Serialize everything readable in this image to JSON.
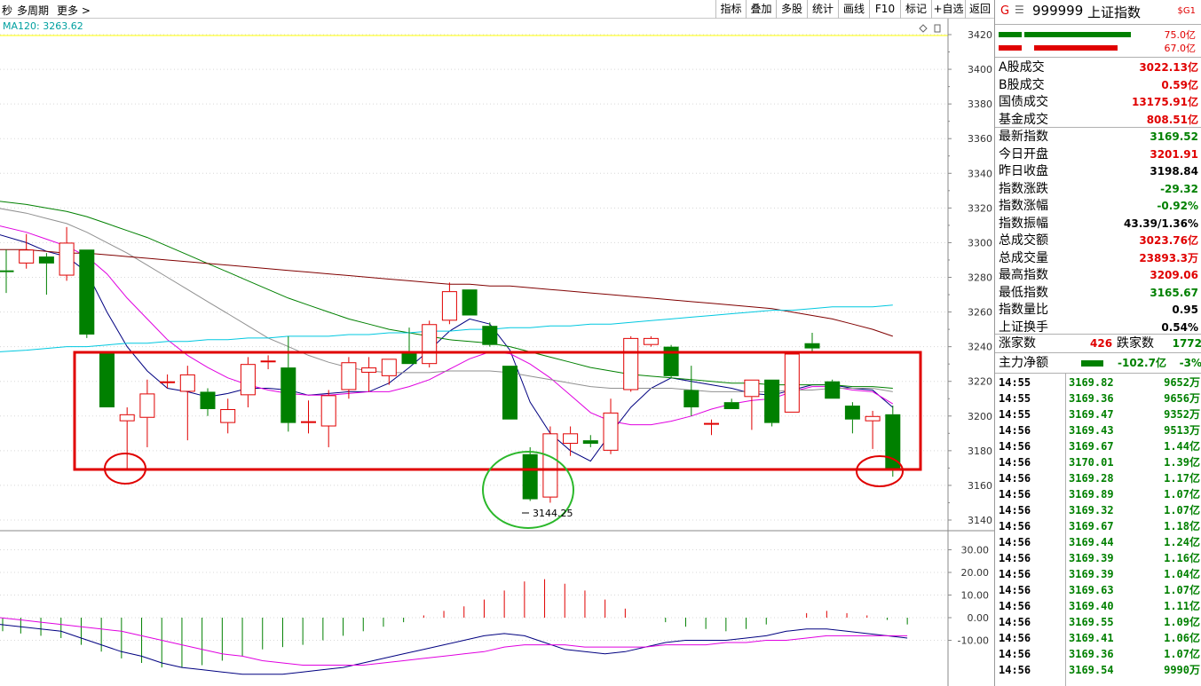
{
  "toolbar": {
    "left_items": [
      "秒",
      "多周期",
      "更多 >"
    ],
    "buttons": [
      "指标",
      "叠加",
      "多股",
      "统计",
      "画线",
      "F10",
      "标记",
      "+自选",
      "返回"
    ]
  },
  "indicator_label": "MA120: 3263.62",
  "quote": {
    "code": "999999",
    "name": "上证指数",
    "badge": "$G1",
    "bar_top_value": "75.0亿",
    "bar_bottom_value": "67.0亿",
    "rows": [
      {
        "label": "A股成交",
        "value": "3022.13亿",
        "color": "red"
      },
      {
        "label": "B股成交",
        "value": "0.59亿",
        "color": "red"
      },
      {
        "label": "国债成交",
        "value": "13175.91亿",
        "color": "red"
      },
      {
        "label": "基金成交",
        "value": "808.51亿",
        "color": "red"
      },
      {
        "label": "最新指数",
        "value": "3169.52",
        "color": "green"
      },
      {
        "label": "今日开盘",
        "value": "3201.91",
        "color": "red"
      },
      {
        "label": "昨日收盘",
        "value": "3198.84",
        "color": "black"
      },
      {
        "label": "指数涨跌",
        "value": "-29.32",
        "color": "green"
      },
      {
        "label": "指数涨幅",
        "value": "-0.92%",
        "color": "green"
      },
      {
        "label": "指数振幅",
        "value": "43.39/1.36%",
        "color": "black"
      },
      {
        "label": "总成交额",
        "value": "3023.76亿",
        "color": "red"
      },
      {
        "label": "总成交量",
        "value": "23893.3万",
        "color": "red"
      },
      {
        "label": "最高指数",
        "value": "3209.06",
        "color": "red"
      },
      {
        "label": "最低指数",
        "value": "3165.67",
        "color": "green"
      },
      {
        "label": "指数量比",
        "value": "0.95",
        "color": "black"
      },
      {
        "label": "上证换手",
        "value": "0.54%",
        "color": "black"
      }
    ],
    "breadth": {
      "up_label": "涨家数",
      "up_value": "426",
      "down_label": "跌家数",
      "down_value": "1772"
    },
    "main_flow": {
      "label": "主力净额",
      "value": "-102.7亿",
      "pct": "-3%"
    },
    "ticks": [
      {
        "time": "14:55",
        "price": "3169.82",
        "vol": "9652万"
      },
      {
        "time": "14:55",
        "price": "3169.36",
        "vol": "9656万"
      },
      {
        "time": "14:55",
        "price": "3169.47",
        "vol": "9352万"
      },
      {
        "time": "14:56",
        "price": "3169.43",
        "vol": "9513万"
      },
      {
        "time": "14:56",
        "price": "3169.67",
        "vol": "1.44亿"
      },
      {
        "time": "14:56",
        "price": "3170.01",
        "vol": "1.39亿"
      },
      {
        "time": "14:56",
        "price": "3169.28",
        "vol": "1.17亿"
      },
      {
        "time": "14:56",
        "price": "3169.89",
        "vol": "1.07亿"
      },
      {
        "time": "14:56",
        "price": "3169.32",
        "vol": "1.07亿"
      },
      {
        "time": "14:56",
        "price": "3169.67",
        "vol": "1.18亿"
      },
      {
        "time": "14:56",
        "price": "3169.44",
        "vol": "1.24亿"
      },
      {
        "time": "14:56",
        "price": "3169.39",
        "vol": "1.16亿"
      },
      {
        "time": "14:56",
        "price": "3169.39",
        "vol": "1.04亿"
      },
      {
        "time": "14:56",
        "price": "3169.63",
        "vol": "1.07亿"
      },
      {
        "time": "14:56",
        "price": "3169.40",
        "vol": "1.11亿"
      },
      {
        "time": "14:56",
        "price": "3169.55",
        "vol": "1.09亿"
      },
      {
        "time": "14:56",
        "price": "3169.41",
        "vol": "1.06亿"
      },
      {
        "time": "14:56",
        "price": "3169.36",
        "vol": "1.07亿"
      },
      {
        "time": "14:56",
        "price": "3169.54",
        "vol": "9990万"
      }
    ],
    "colors": {
      "red": "#e00000",
      "green": "#008000",
      "black": "#000000"
    }
  },
  "chart_data": {
    "type": "candlestick",
    "price_axis": {
      "min": 3140,
      "max": 3420,
      "ticks": [
        3140,
        3160,
        3180,
        3200,
        3220,
        3240,
        3260,
        3280,
        3300,
        3320,
        3340,
        3360,
        3380,
        3400,
        3420
      ]
    },
    "macd_axis": {
      "min": -10,
      "max": 30,
      "ticks": [
        "30.00",
        "20.00",
        "10.00",
        "0.00",
        "-10.00"
      ]
    },
    "annotation": "3144.25",
    "candles": [
      {
        "o": 3284,
        "h": 3296,
        "l": 3271,
        "c": 3283
      },
      {
        "o": 3288,
        "h": 3305,
        "l": 3285,
        "c": 3296
      },
      {
        "o": 3292,
        "h": 3294,
        "l": 3270,
        "c": 3288
      },
      {
        "o": 3281,
        "h": 3309,
        "l": 3278,
        "c": 3300
      },
      {
        "o": 3296,
        "h": 3296,
        "l": 3245,
        "c": 3247
      },
      {
        "o": 3237,
        "h": 3237,
        "l": 3205,
        "c": 3205
      },
      {
        "o": 3197,
        "h": 3205,
        "l": 3169,
        "c": 3201
      },
      {
        "o": 3199,
        "h": 3221,
        "l": 3182,
        "c": 3213
      },
      {
        "o": 3219,
        "h": 3224,
        "l": 3216,
        "c": 3220
      },
      {
        "o": 3214,
        "h": 3229,
        "l": 3186,
        "c": 3224
      },
      {
        "o": 3214,
        "h": 3216,
        "l": 3200,
        "c": 3204
      },
      {
        "o": 3196,
        "h": 3210,
        "l": 3190,
        "c": 3204
      },
      {
        "o": 3212,
        "h": 3234,
        "l": 3205,
        "c": 3230
      },
      {
        "o": 3231,
        "h": 3235,
        "l": 3227,
        "c": 3232
      },
      {
        "o": 3228,
        "h": 3246,
        "l": 3191,
        "c": 3196
      },
      {
        "o": 3196,
        "h": 3209,
        "l": 3190,
        "c": 3197
      },
      {
        "o": 3194,
        "h": 3215,
        "l": 3182,
        "c": 3212
      },
      {
        "o": 3215,
        "h": 3234,
        "l": 3210,
        "c": 3231
      },
      {
        "o": 3225,
        "h": 3234,
        "l": 3214,
        "c": 3228
      },
      {
        "o": 3223,
        "h": 3233,
        "l": 3218,
        "c": 3233
      },
      {
        "o": 3237,
        "h": 3251,
        "l": 3230,
        "c": 3230
      },
      {
        "o": 3230,
        "h": 3255,
        "l": 3228,
        "c": 3253
      },
      {
        "o": 3255,
        "h": 3277,
        "l": 3253,
        "c": 3272
      },
      {
        "o": 3273,
        "h": 3273,
        "l": 3258,
        "c": 3258
      },
      {
        "o": 3252,
        "h": 3254,
        "l": 3240,
        "c": 3241
      },
      {
        "o": 3229,
        "h": 3229,
        "l": 3198,
        "c": 3198
      },
      {
        "o": 3178,
        "h": 3182,
        "l": 3151,
        "c": 3152
      },
      {
        "o": 3153,
        "h": 3194,
        "l": 3150,
        "c": 3190
      },
      {
        "o": 3184,
        "h": 3194,
        "l": 3177,
        "c": 3190
      },
      {
        "o": 3186,
        "h": 3189,
        "l": 3182,
        "c": 3184
      },
      {
        "o": 3180,
        "h": 3210,
        "l": 3178,
        "c": 3202
      },
      {
        "o": 3215,
        "h": 3246,
        "l": 3214,
        "c": 3245
      },
      {
        "o": 3241,
        "h": 3246,
        "l": 3240,
        "c": 3245
      },
      {
        "o": 3240,
        "h": 3241,
        "l": 3222,
        "c": 3223
      },
      {
        "o": 3215,
        "h": 3229,
        "l": 3200,
        "c": 3205
      },
      {
        "o": 3195,
        "h": 3198,
        "l": 3189,
        "c": 3196
      },
      {
        "o": 3208,
        "h": 3210,
        "l": 3204,
        "c": 3204
      },
      {
        "o": 3211,
        "h": 3221,
        "l": 3192,
        "c": 3221
      },
      {
        "o": 3221,
        "h": 3221,
        "l": 3194,
        "c": 3196
      },
      {
        "o": 3202,
        "h": 3237,
        "l": 3202,
        "c": 3236
      },
      {
        "o": 3242,
        "h": 3248,
        "l": 3236,
        "c": 3239
      },
      {
        "o": 3220,
        "h": 3221,
        "l": 3210,
        "c": 3210
      },
      {
        "o": 3206,
        "h": 3208,
        "l": 3190,
        "c": 3198
      },
      {
        "o": 3197,
        "h": 3203,
        "l": 3181,
        "c": 3200
      },
      {
        "o": 3201,
        "h": 3206,
        "l": 3165,
        "c": 3169
      }
    ],
    "ma_lines": [
      {
        "name": "MA5",
        "color": "#000080",
        "values": [
          3305,
          3300,
          3295,
          3292,
          3283,
          3260,
          3240,
          3226,
          3216,
          3214,
          3211,
          3213,
          3216,
          3216,
          3215,
          3212,
          3213,
          3214,
          3214,
          3219,
          3228,
          3238,
          3249,
          3256,
          3253,
          3238,
          3208,
          3190,
          3180,
          3174,
          3190,
          3205,
          3216,
          3222,
          3220,
          3218,
          3216,
          3213,
          3212,
          3215,
          3218,
          3218,
          3216,
          3215,
          3205
        ]
      },
      {
        "name": "MA10",
        "color": "#e000e0",
        "values": [
          3310,
          3306,
          3302,
          3298,
          3292,
          3282,
          3268,
          3256,
          3244,
          3235,
          3228,
          3222,
          3218,
          3215,
          3213,
          3212,
          3212,
          3213,
          3214,
          3214,
          3217,
          3221,
          3227,
          3233,
          3237,
          3236,
          3230,
          3222,
          3212,
          3202,
          3197,
          3195,
          3195,
          3197,
          3200,
          3204,
          3207,
          3209,
          3210,
          3214,
          3217,
          3217,
          3215,
          3214,
          3207
        ]
      },
      {
        "name": "MA20",
        "color": "#909090",
        "values": [
          3320,
          3317,
          3314,
          3311,
          3306,
          3300,
          3294,
          3287,
          3280,
          3273,
          3266,
          3259,
          3252,
          3245,
          3240,
          3235,
          3231,
          3228,
          3226,
          3225,
          3225,
          3225,
          3226,
          3226,
          3226,
          3225,
          3223,
          3221,
          3219,
          3217,
          3216,
          3216,
          3216,
          3216,
          3215,
          3214,
          3214,
          3214,
          3214,
          3215,
          3215,
          3216,
          3216,
          3216,
          3214
        ]
      },
      {
        "name": "MA30",
        "color": "#008000",
        "values": [
          3324,
          3322,
          3320,
          3318,
          3315,
          3311,
          3307,
          3303,
          3298,
          3293,
          3288,
          3283,
          3278,
          3273,
          3268,
          3264,
          3260,
          3256,
          3253,
          3250,
          3248,
          3246,
          3244,
          3243,
          3242,
          3240,
          3237,
          3234,
          3231,
          3228,
          3226,
          3224,
          3223,
          3222,
          3221,
          3220,
          3219,
          3219,
          3218,
          3218,
          3218,
          3218,
          3217,
          3217,
          3216
        ]
      },
      {
        "name": "MA60",
        "color": "#800000",
        "values": [
          3296,
          3296,
          3295,
          3294,
          3294,
          3293,
          3292,
          3291,
          3290,
          3289,
          3288,
          3287,
          3286,
          3285,
          3284,
          3283,
          3282,
          3281,
          3280,
          3279,
          3278,
          3277,
          3276,
          3276,
          3275,
          3275,
          3274,
          3273,
          3272,
          3271,
          3270,
          3269,
          3268,
          3267,
          3266,
          3265,
          3264,
          3263,
          3262,
          3260,
          3258,
          3256,
          3253,
          3250,
          3246
        ]
      },
      {
        "name": "MA120",
        "color": "#00c8e0",
        "values": [
          3237,
          3238,
          3239,
          3240,
          3240,
          3241,
          3242,
          3242,
          3243,
          3243,
          3244,
          3244,
          3245,
          3245,
          3246,
          3246,
          3246,
          3247,
          3247,
          3248,
          3248,
          3249,
          3249,
          3250,
          3250,
          3251,
          3251,
          3252,
          3252,
          3253,
          3253,
          3254,
          3255,
          3256,
          3257,
          3258,
          3259,
          3260,
          3261,
          3261,
          3262,
          3263,
          3263,
          3263,
          3264
        ]
      }
    ],
    "macd": {
      "hist": [
        -6,
        -7,
        -8,
        -9,
        -12,
        -15,
        -18,
        -20,
        -22,
        -22,
        -21,
        -19,
        -17,
        -14,
        -13,
        -12,
        -10,
        -8,
        -6,
        -4,
        -2,
        1,
        3,
        5,
        8,
        12,
        16,
        17,
        15,
        12,
        8,
        4,
        0,
        -2,
        -4,
        -5,
        -6,
        -5,
        -3,
        0,
        2,
        3,
        2,
        1,
        -1,
        -3
      ],
      "dif": [
        -3,
        -4,
        -5,
        -6,
        -9,
        -12,
        -15,
        -17,
        -20,
        -22,
        -23,
        -24,
        -25,
        -25,
        -25,
        -24,
        -23,
        -22,
        -20,
        -18,
        -16,
        -14,
        -12,
        -10,
        -8,
        -7,
        -8,
        -11,
        -14,
        -15,
        -16,
        -15,
        -13,
        -11,
        -10,
        -10,
        -10,
        -9,
        -8,
        -6,
        -5,
        -5,
        -6,
        -7,
        -8,
        -9
      ],
      "dea": [
        0,
        -1,
        -2,
        -3,
        -4,
        -5,
        -6,
        -8,
        -10,
        -12,
        -14,
        -16,
        -17,
        -19,
        -20,
        -21,
        -21,
        -21,
        -21,
        -20,
        -19,
        -18,
        -17,
        -16,
        -15,
        -13,
        -12,
        -12,
        -12,
        -13,
        -13,
        -13,
        -13,
        -12,
        -12,
        -12,
        -11,
        -11,
        -10,
        -10,
        -9,
        -8,
        -8,
        -8,
        -8,
        -8
      ]
    }
  }
}
